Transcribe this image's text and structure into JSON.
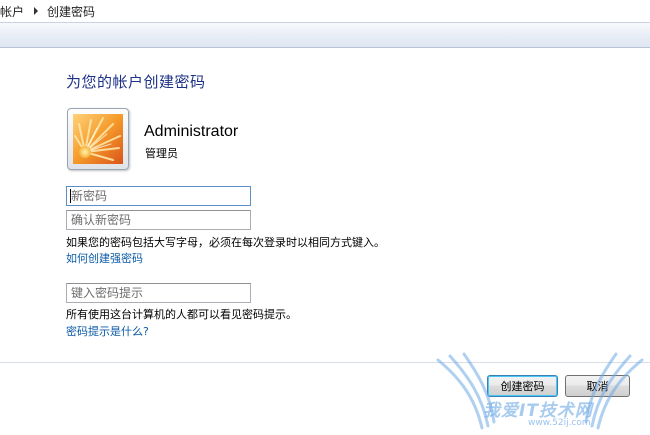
{
  "breadcrumb": {
    "items": [
      "帐户",
      "创建密码"
    ]
  },
  "page": {
    "title": "为您的帐户创建密码"
  },
  "user": {
    "name": "Administrator",
    "role": "管理员",
    "avatar_icon": "orange-flower-icon"
  },
  "form": {
    "new_password_placeholder": "新密码",
    "confirm_password_placeholder": "确认新密码",
    "case_note": "如果您的密码包括大写字母，必须在每次登录时以相同方式键入。",
    "strong_password_link": "如何创建强密码",
    "hint_placeholder": "键入密码提示",
    "hint_note": "所有使用这台计算机的人都可以看见密码提示。",
    "hint_help_link": "密码提示是什么?"
  },
  "buttons": {
    "create": "创建密码",
    "cancel": "取消"
  },
  "watermark": {
    "text": "我爱IT技术网",
    "url": "www.52ij.com"
  },
  "colors": {
    "title": "#1e3287",
    "link": "#0b5aa8",
    "default_button_border": "#3c7fb1"
  }
}
